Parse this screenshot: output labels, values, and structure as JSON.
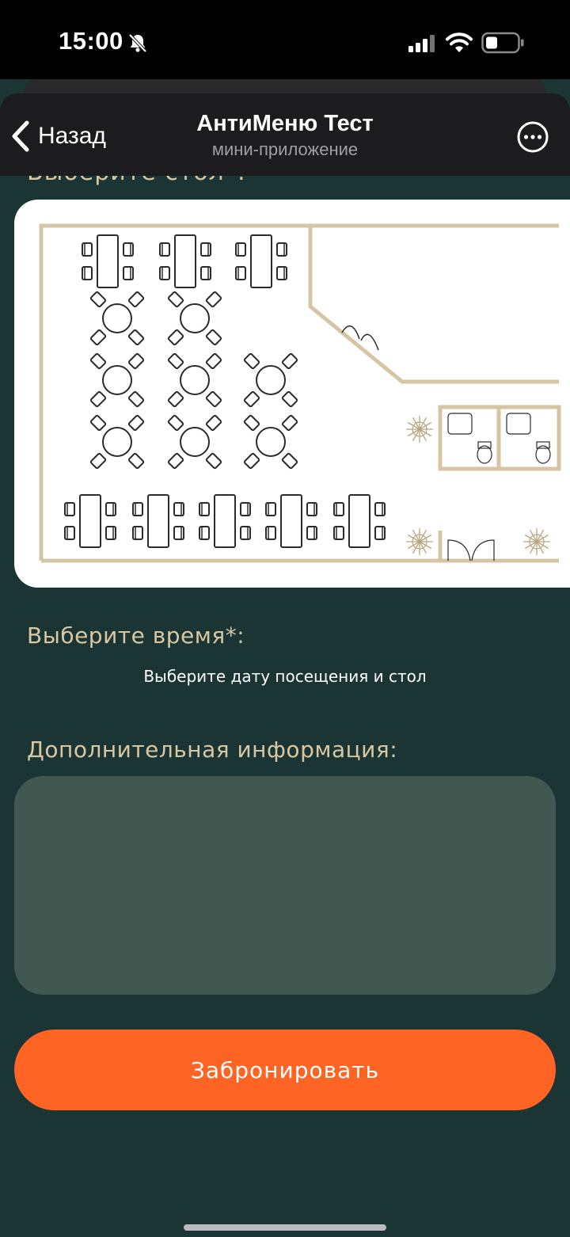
{
  "status_bar": {
    "time": "15:00",
    "icons": [
      "bell-slash-icon",
      "signal-icon",
      "wifi-icon",
      "battery-icon"
    ]
  },
  "header": {
    "back_label": "Назад",
    "title": "АнтиМеню Тест",
    "subtitle": "мини-приложение",
    "more_icon": "ellipsis-circle-icon"
  },
  "form": {
    "table_label_cut": "Выберите стол*:",
    "time_label": "Выберите время*:",
    "time_hint": "Выберите дату посещения и стол",
    "info_label": "Дополнительная информация:",
    "info_value": "",
    "submit_label": "Забронировать"
  },
  "floor_plan": {
    "tables": {
      "top_rectangular": 3,
      "round_rows": [
        2,
        3,
        3
      ],
      "bottom_rectangular": 5
    },
    "restrooms": 2,
    "plants": 3
  },
  "colors": {
    "background": "#1b3434",
    "accent": "#fe6423",
    "label": "#d8c7a3",
    "field": "#41574f",
    "wall": "#d6c5a5"
  }
}
